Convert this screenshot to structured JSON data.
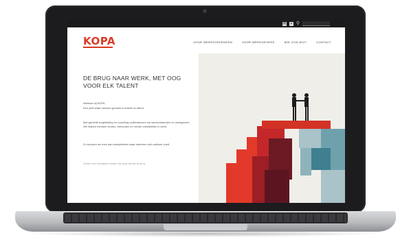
{
  "topbar": {
    "icons": [
      "mail-icon",
      "social-icon",
      "search-icon"
    ],
    "search_placeholder": ""
  },
  "header": {
    "logo_text": "KOPA",
    "nav": [
      "VOOR WERKZOEKENDEN",
      "VOOR WERKGEVERS",
      "WIE ZIJN WIJ?",
      "CONTACT"
    ]
  },
  "main": {
    "headline": "DE BRUG NAAR WERK, MET OOG VOOR ELK TALENT",
    "intro_line1": "Welkom bij KOPA.",
    "intro_line2": "Een plek waar mensen groeien in kracht en talent.",
    "paragraph2": "Met gerichte begeleiding en coaching ondersteunen we werkzoekenden en werkgevers. We helpen mensen vinden, behouden en verder ontwikkelen in werk.",
    "paragraph3": "Zo bouwen we mee aan werkplekken waar iedereen zich welkom voelt.",
    "footer_note": "Verder een werkplek vinden die past bij wie je bent."
  },
  "hero": {
    "colors": {
      "background": "#efeee9",
      "red_light": "#e2392a",
      "red_dark": "#9d1e24",
      "maroon": "#6b1a24",
      "teal_light": "#a9c3c8",
      "teal": "#6fa1ad",
      "teal_dark": "#3f7f8f",
      "figures": "#1d1d1f"
    }
  },
  "brand": {
    "accent": "#d93b24"
  }
}
